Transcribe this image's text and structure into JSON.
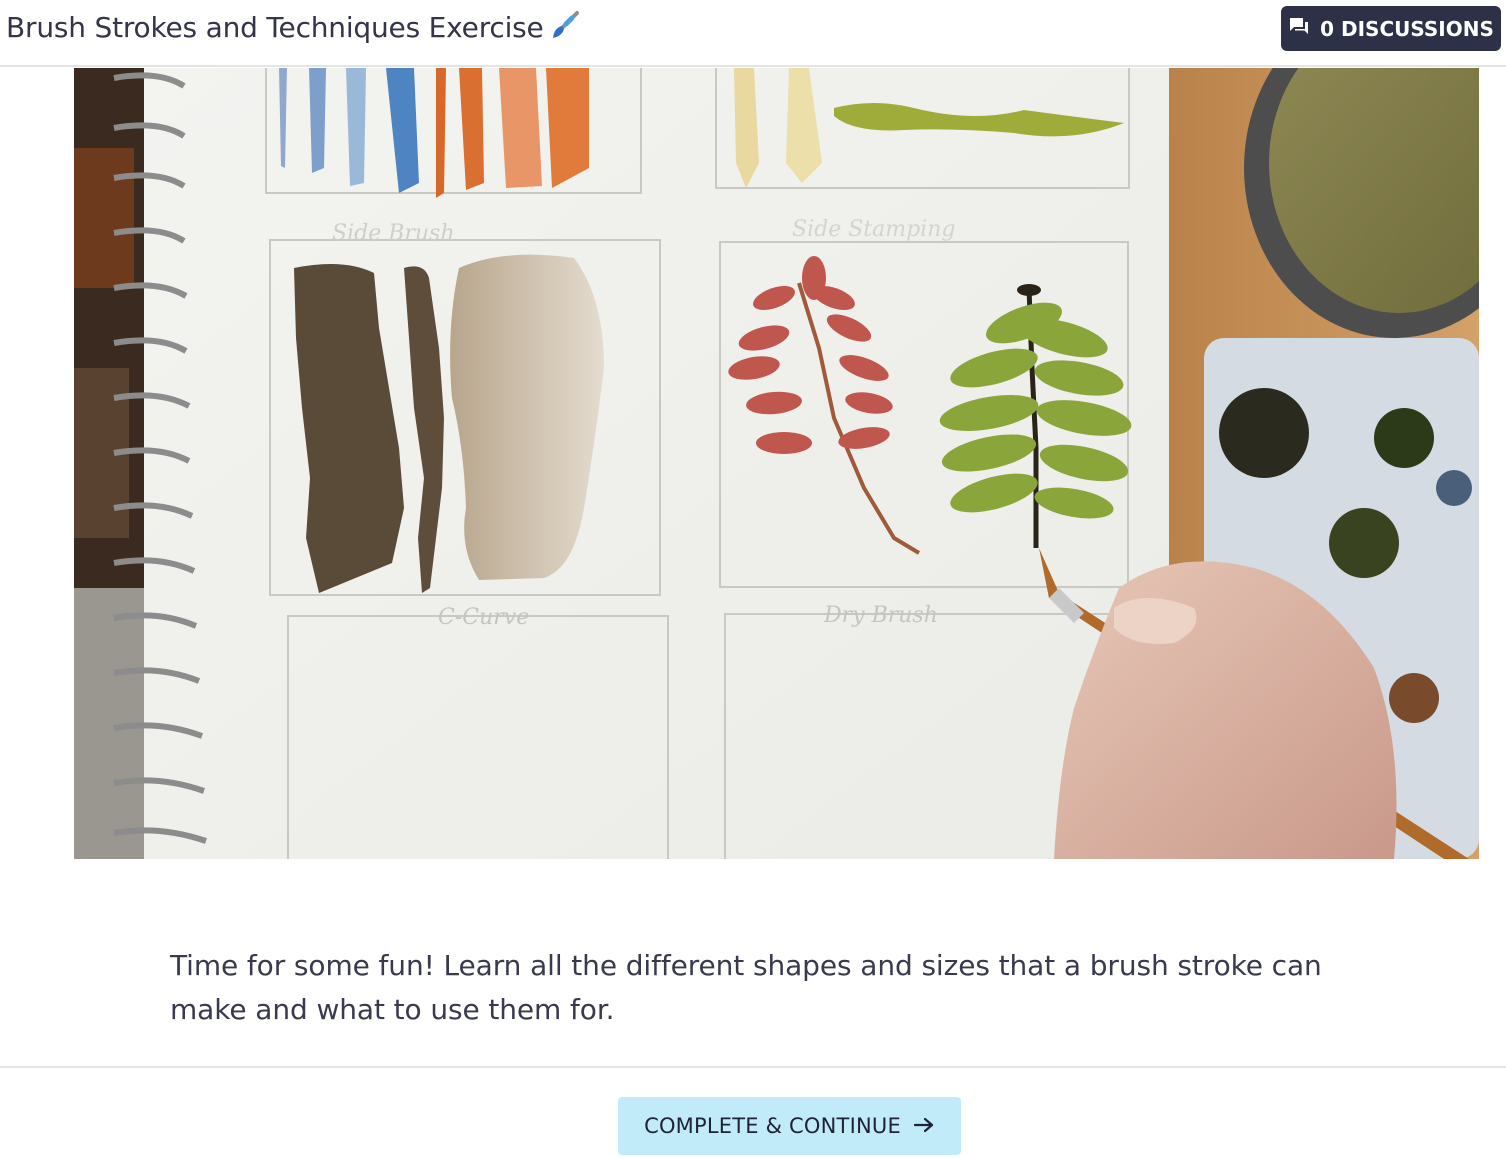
{
  "header": {
    "title": "Brush Strokes and Techniques Exercise",
    "discussions_label": "0 DISCUSSIONS"
  },
  "media": {
    "sketch_labels": [
      "Side Brush",
      "Side Stamping",
      "C-Curve",
      "Dry Brush"
    ]
  },
  "description": "Time for some fun! Learn all the different shapes and sizes that a brush stroke can make and what to use them for.",
  "footer": {
    "complete_label": "COMPLETE & CONTINUE"
  },
  "colors": {
    "discuss_bg": "#2d3147",
    "complete_bg": "#c2ebfa",
    "text": "#3a3a4e"
  }
}
